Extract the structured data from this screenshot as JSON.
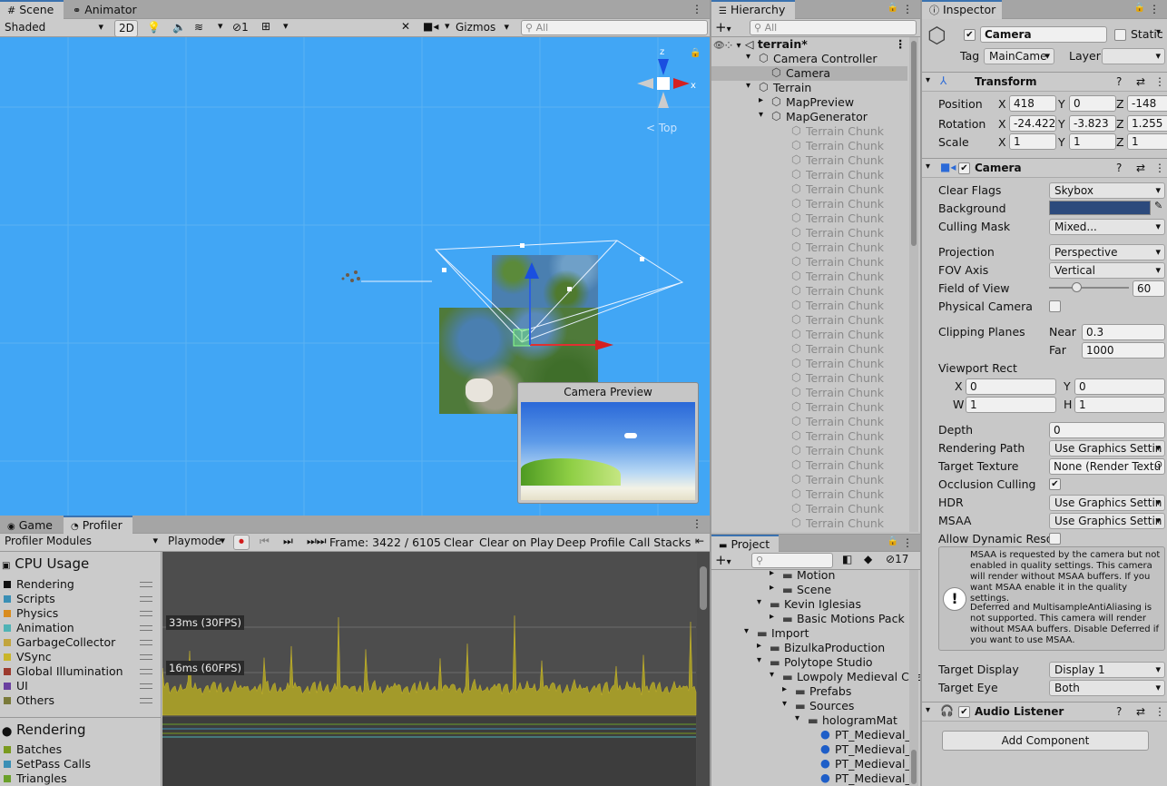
{
  "scene": {
    "tabs": [
      "Scene",
      "Animator"
    ],
    "shading": "Shaded",
    "mode_2d": "2D",
    "hidden_count": "1",
    "gizmos": "Gizmos",
    "search_placeholder": "All",
    "orientation": "Top",
    "camera_preview_title": "Camera Preview"
  },
  "hierarchy": {
    "tab": "Hierarchy",
    "search_placeholder": "All",
    "scene_name": "terrain*",
    "items": [
      {
        "label": "Camera Controller",
        "indent": 1,
        "state": "expanded"
      },
      {
        "label": "Camera",
        "indent": 2,
        "state": "none",
        "selected": true
      },
      {
        "label": "Terrain",
        "indent": 1,
        "state": "expanded"
      },
      {
        "label": "MapPreview",
        "indent": 2,
        "state": "collapsed"
      },
      {
        "label": "MapGenerator",
        "indent": 2,
        "state": "expanded"
      }
    ],
    "chunk_label": "Terrain Chunk",
    "chunk_count": 28
  },
  "inspector": {
    "tab": "Inspector",
    "object_name": "Camera",
    "static_label": "Static",
    "tag_label": "Tag",
    "tag_value": "MainCame",
    "layer_label": "Layer",
    "layer_value": "",
    "transform": {
      "title": "Transform",
      "position_label": "Position",
      "rotation_label": "Rotation",
      "scale_label": "Scale",
      "position": {
        "x": "418",
        "y": "0",
        "z": "-148"
      },
      "rotation": {
        "x": "-24.422",
        "y": "-3.823",
        "z": "1.255"
      },
      "scale": {
        "x": "1",
        "y": "1",
        "z": "1"
      }
    },
    "camera": {
      "title": "Camera",
      "clear_flags_label": "Clear Flags",
      "clear_flags": "Skybox",
      "background_label": "Background",
      "background_color": "#2c4a7c",
      "culling_mask_label": "Culling Mask",
      "culling_mask": "Mixed...",
      "projection_label": "Projection",
      "projection": "Perspective",
      "fov_axis_label": "FOV Axis",
      "fov_axis": "Vertical",
      "fov_label": "Field of View",
      "fov": "60",
      "fov_fraction": 0.33,
      "physical_label": "Physical Camera",
      "clipping_label": "Clipping Planes",
      "near_label": "Near",
      "near": "0.3",
      "far_label": "Far",
      "far": "1000",
      "viewport_label": "Viewport Rect",
      "vp_x": "0",
      "vp_y": "0",
      "vp_w": "1",
      "vp_h": "1",
      "depth_label": "Depth",
      "depth": "0",
      "rendering_path_label": "Rendering Path",
      "rendering_path": "Use Graphics Settin",
      "target_texture_label": "Target Texture",
      "target_texture": "None (Render Textu",
      "occlusion_label": "Occlusion Culling",
      "hdr_label": "HDR",
      "hdr": "Use Graphics Settin",
      "msaa_label": "MSAA",
      "msaa": "Use Graphics Settin",
      "dynres_label": "Allow Dynamic Resol",
      "help_text_1": "MSAA is requested by the camera but not enabled in quality settings. This camera will render without MSAA buffers. If you want MSAA enable it in the quality settings.",
      "help_text_2": "Deferred and MultisampleAntiAliasing is not supported. This camera will render without MSAA buffers. Disable Deferred if you want to use MSAA.",
      "target_display_label": "Target Display",
      "target_display": "Display 1",
      "target_eye_label": "Target Eye",
      "target_eye": "Both"
    },
    "audio_listener": "Audio Listener",
    "add_component": "Add Component"
  },
  "profiler": {
    "tabs": [
      "Game",
      "Profiler"
    ],
    "modules_label": "Profiler Modules",
    "playmode": "Playmode",
    "frame": "Frame: 3422 / 6105",
    "buttons": [
      "Clear",
      "Clear on Play",
      "Deep Profile",
      "Call Stacks"
    ],
    "cpu_title": "CPU Usage",
    "cpu_items": [
      {
        "label": "Rendering",
        "color": "#111111"
      },
      {
        "label": "Scripts",
        "color": "#3a8fb5"
      },
      {
        "label": "Physics",
        "color": "#d98c1e"
      },
      {
        "label": "Animation",
        "color": "#4fb3b5"
      },
      {
        "label": "GarbageCollector",
        "color": "#c2a53d"
      },
      {
        "label": "VSync",
        "color": "#c9b52a"
      },
      {
        "label": "Global Illumination",
        "color": "#9c3a2e"
      },
      {
        "label": "UI",
        "color": "#6a3fa0"
      },
      {
        "label": "Others",
        "color": "#7a7a3a"
      }
    ],
    "line_33": "33ms (30FPS)",
    "line_16": "16ms (60FPS)",
    "rendering_title": "Rendering",
    "rendering_items": [
      {
        "label": "Batches",
        "color": "#7a9a1e"
      },
      {
        "label": "SetPass Calls",
        "color": "#3a8fb5"
      },
      {
        "label": "Triangles",
        "color": "#6aa02a"
      }
    ]
  },
  "project": {
    "tab": "Project",
    "hidden_count": "17",
    "items": [
      {
        "label": "Motion",
        "indent": 2,
        "state": "collapsed",
        "icon": "folder"
      },
      {
        "label": "Scene",
        "indent": 2,
        "state": "collapsed",
        "icon": "folder"
      },
      {
        "label": "Kevin Iglesias",
        "indent": 1,
        "state": "expanded",
        "icon": "folder"
      },
      {
        "label": "Basic Motions Pack",
        "indent": 2,
        "state": "collapsed",
        "icon": "folder"
      },
      {
        "label": "Import",
        "indent": 0,
        "state": "expanded",
        "icon": "folder"
      },
      {
        "label": "BizulkaProduction",
        "indent": 1,
        "state": "collapsed",
        "icon": "folder"
      },
      {
        "label": "Polytope Studio",
        "indent": 1,
        "state": "expanded",
        "icon": "folder"
      },
      {
        "label": "Lowpoly Medieval Cha",
        "indent": 2,
        "state": "expanded",
        "icon": "folder"
      },
      {
        "label": "Prefabs",
        "indent": 3,
        "state": "collapsed",
        "icon": "folder"
      },
      {
        "label": "Sources",
        "indent": 3,
        "state": "expanded",
        "icon": "folder"
      },
      {
        "label": "hologramMat",
        "indent": 4,
        "state": "expanded",
        "icon": "folder"
      },
      {
        "label": "PT_Medieval_E",
        "indent": 5,
        "state": "none",
        "icon": "material"
      },
      {
        "label": "PT_Medieval_F",
        "indent": 5,
        "state": "none",
        "icon": "material"
      },
      {
        "label": "PT_Medieval_H",
        "indent": 5,
        "state": "none",
        "icon": "material"
      },
      {
        "label": "PT_Medieval_n",
        "indent": 5,
        "state": "none",
        "icon": "material"
      }
    ]
  }
}
